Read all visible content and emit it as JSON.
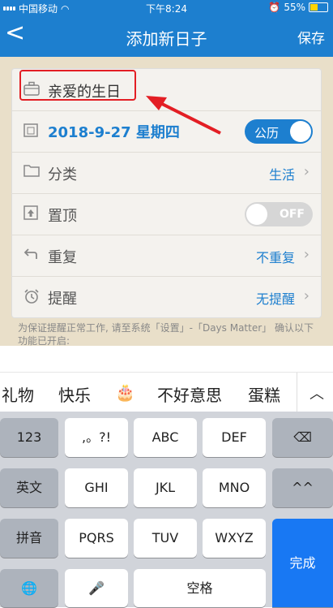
{
  "status": {
    "carrier": "中国移动",
    "time": "下午8:24",
    "battery": "55%"
  },
  "nav": {
    "back": "<",
    "title": "添加新日子",
    "save": "保存"
  },
  "form": {
    "name": "亲爱的生日",
    "date": "2018-9-27 星期四",
    "calendar_toggle": "公历",
    "category_label": "分类",
    "category_value": "生活",
    "top_label": "置顶",
    "top_toggle": "OFF",
    "repeat_label": "重复",
    "repeat_value": "不重复",
    "remind_label": "提醒",
    "remind_value": "无提醒",
    "chevron": "›"
  },
  "note": "为保证提醒正常工作, 请至系统「设置」-「Days Matter」 确认以下功能已开启:",
  "candidates": [
    "礼物",
    "快乐",
    "🎂",
    "不好意思",
    "蛋糕"
  ],
  "candidate_up": "︿",
  "keyboard": {
    "row1": [
      "123",
      ",。?!",
      "ABC",
      "DEF",
      "⌫"
    ],
    "row2": [
      "英文",
      "GHI",
      "JKL",
      "MNO",
      "^^"
    ],
    "row3": [
      "拼音",
      "PQRS",
      "TUV",
      "WXYZ"
    ],
    "done": "完成",
    "globe": "🌐",
    "mic": "🎤",
    "space": "空格"
  },
  "colors": {
    "brand_blue": "#1d7fcf",
    "highlight_red": "#e31e24"
  }
}
